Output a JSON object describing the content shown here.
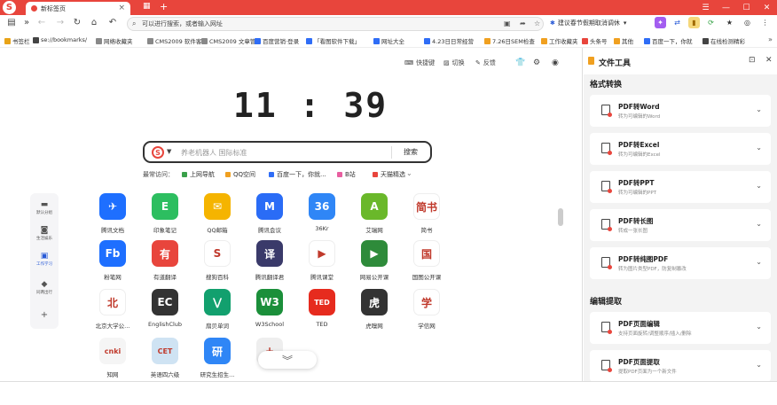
{
  "window": {
    "tab_title": "新标签页",
    "new_tab_icon": "grid-icon",
    "controls": [
      "menu-icon",
      "minimize-icon",
      "maximize-icon",
      "close-icon"
    ]
  },
  "address_bar": {
    "placeholder": "可以进行搜索，或者输入网址",
    "hint": "建议春节假期取消调休"
  },
  "bookmarks": [
    {
      "label": "书签栏",
      "color": "#e8a317"
    },
    {
      "label": "se://bookmarks/",
      "color": "#444444"
    },
    {
      "label": "网络收藏夹",
      "color": "#888888"
    },
    {
      "label": "CMS2009 软件客",
      "color": "#888888"
    },
    {
      "label": "CMS2009 文章管",
      "color": "#888888"
    },
    {
      "label": "百度营销·登录",
      "color": "#2f6df6"
    },
    {
      "label": "「看图软件下载」",
      "color": "#2f6df6"
    },
    {
      "label": "网址大全",
      "color": "#2f6df6"
    },
    {
      "label": "4.23日日常经营",
      "color": "#2f6df6"
    },
    {
      "label": "7.26日SEM检查",
      "color": "#f0a020"
    },
    {
      "label": "工作收藏夹",
      "color": "#f0a020"
    },
    {
      "label": "头条号",
      "color": "#e8453c"
    },
    {
      "label": "其他",
      "color": "#f0a020"
    },
    {
      "label": "百度一下，你就",
      "color": "#2f6df6"
    },
    {
      "label": "在线检测精彩",
      "color": "#444444"
    }
  ],
  "newtab": {
    "top_tools": [
      "快捷键",
      "切换",
      "反馈"
    ],
    "clock": "11 : 39",
    "search": {
      "placeholder": "养老机器人 国际标准",
      "button": "搜索"
    },
    "frequent_label": "最常访问：",
    "frequent": [
      {
        "label": "上网导航",
        "color": "#3aa04a"
      },
      {
        "label": "QQ空间",
        "color": "#f0a020"
      },
      {
        "label": "百度一下，你就...",
        "color": "#2f6df6"
      },
      {
        "label": "B站",
        "color": "#e85fa0"
      },
      {
        "label": "天猫精选",
        "color": "#e8453c"
      }
    ],
    "sidenav": [
      {
        "label": "默认分组",
        "icon": "folder-icon"
      },
      {
        "label": "生活娱乐",
        "icon": "game-icon"
      },
      {
        "label": "工作学习",
        "icon": "briefcase-icon"
      },
      {
        "label": "同两出行",
        "icon": "tag-icon"
      }
    ],
    "apps": [
      {
        "label": "腾讯文档",
        "color": "#1e6fff",
        "glyph": "✈"
      },
      {
        "label": "印象笔记",
        "color": "#2dbe60",
        "glyph": "E"
      },
      {
        "label": "QQ邮箱",
        "color": "#f5b400",
        "glyph": "✉"
      },
      {
        "label": "腾讯会议",
        "color": "#2a6cf6",
        "glyph": "M"
      },
      {
        "label": "36Kr",
        "color": "#2f86f6",
        "glyph": "36"
      },
      {
        "label": "艾瑞网",
        "color": "#6ab82a",
        "glyph": "A"
      },
      {
        "label": "简书",
        "color": "#ffffff",
        "glyph": "简书"
      },
      {
        "label": "粉笔网",
        "color": "#1e6fff",
        "glyph": "Fb"
      },
      {
        "label": "有道翻译",
        "color": "#e8453c",
        "glyph": "有"
      },
      {
        "label": "搜狗百科",
        "color": "#ffffff",
        "glyph": "S"
      },
      {
        "label": "腾讯翻译君",
        "color": "#3a3a6a",
        "glyph": "译"
      },
      {
        "label": "腾讯课堂",
        "color": "#ffffff",
        "glyph": "▶"
      },
      {
        "label": "网易公开课",
        "color": "#2e8b3a",
        "glyph": "▶"
      },
      {
        "label": "国图公开课",
        "color": "#ffffff",
        "glyph": "国"
      },
      {
        "label": "北京大学公...",
        "color": "#ffffff",
        "glyph": "北"
      },
      {
        "label": "EnglishClub",
        "color": "#333333",
        "glyph": "EC"
      },
      {
        "label": "扇贝单词",
        "color": "#12a06e",
        "glyph": "⋁"
      },
      {
        "label": "W3School",
        "color": "#1b8f3a",
        "glyph": "W3"
      },
      {
        "label": "TED",
        "color": "#e62b1e",
        "glyph": "TED"
      },
      {
        "label": "虎嗅网",
        "color": "#333333",
        "glyph": "虎"
      },
      {
        "label": "学信网",
        "color": "#ffffff",
        "glyph": "学"
      },
      {
        "label": "知网",
        "color": "#f5f5f5",
        "glyph": "cnki"
      },
      {
        "label": "英语四六级",
        "color": "#cfe3f3",
        "glyph": "CET"
      },
      {
        "label": "研究生招生...",
        "color": "#2f86f6",
        "glyph": "研"
      },
      {
        "label": "",
        "color": "#eeeeee",
        "glyph": "+"
      }
    ]
  },
  "panel": {
    "title": "文件工具",
    "sections": [
      {
        "title": "格式转换",
        "cards": [
          {
            "title": "PDF转Word",
            "sub": "转为可编辑的Word"
          },
          {
            "title": "PDF转Excel",
            "sub": "转为可编辑的Excel"
          },
          {
            "title": "PDF转PPT",
            "sub": "转为可编辑的PPT"
          },
          {
            "title": "PDF转长图",
            "sub": "转成一张长图"
          },
          {
            "title": "PDF转纯图PDF",
            "sub": "转为图片类型PDF，防复制篡改"
          }
        ]
      },
      {
        "title": "编辑提取",
        "cards": [
          {
            "title": "PDF页面编辑",
            "sub": "支持页面旋转/调整顺序/插入/删除"
          },
          {
            "title": "PDF页面提取",
            "sub": "提取PDF页面为一个新文件"
          }
        ]
      }
    ]
  }
}
